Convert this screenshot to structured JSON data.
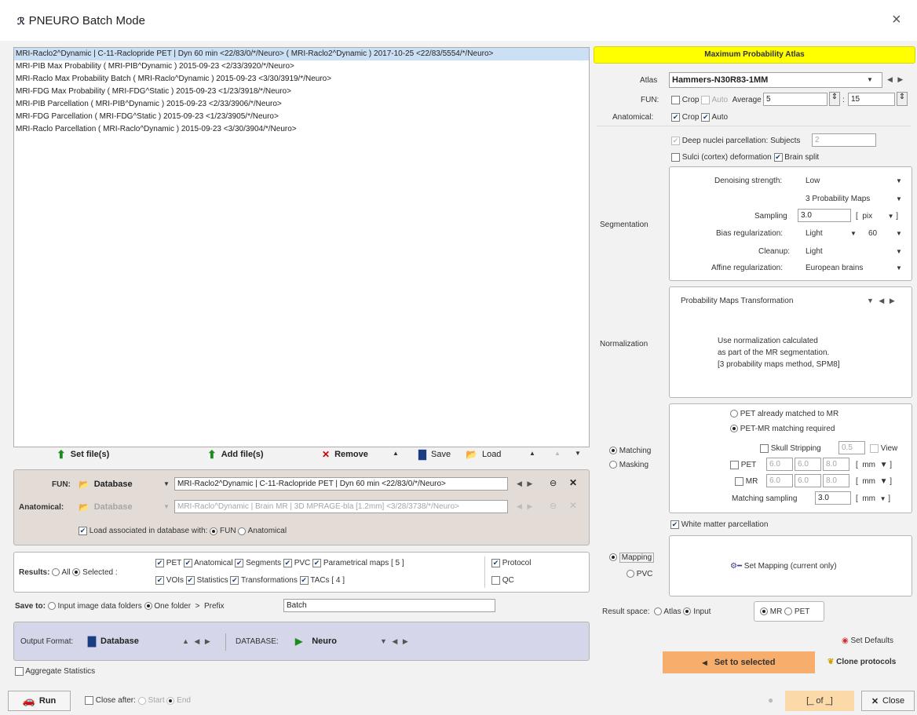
{
  "window": {
    "title": "PNEURO Batch Mode",
    "close": "×"
  },
  "list": [
    "MRI-Raclo2^Dynamic | C-11-Raclopride PET | Dyn 60 min <22/83/0/*/Neuro> ( MRI-Raclo2^Dynamic ) 2017-10-25 <22/83/5554/*/Neuro>",
    "MRI-PIB Max Probability ( MRI-PIB^Dynamic ) 2015-09-23 <2/33/3920/*/Neuro>",
    "MRI-Raclo Max Probability Batch ( MRI-Raclo^Dynamic ) 2015-09-23 <3/30/3919/*/Neuro>",
    "MRI-FDG Max Probability ( MRI-FDG^Static ) 2015-09-23 <1/23/3918/*/Neuro>",
    "MRI-PIB Parcellation ( MRI-PIB^Dynamic ) 2015-09-23 <2/33/3906/*/Neuro>",
    "MRI-FDG Parcellation ( MRI-FDG^Static ) 2015-09-23 <1/23/3905/*/Neuro>",
    "MRI-Raclo Parcellation ( MRI-Raclo^Dynamic ) 2015-09-23 <3/30/3904/*/Neuro>"
  ],
  "toolbar": {
    "set_files": "Set file(s)",
    "add_files": "Add file(s)",
    "remove": "Remove",
    "save": "Save",
    "load": "Load"
  },
  "inputs": {
    "fun_label": "FUN:",
    "fun_source": "Database",
    "fun_value": "MRI-Raclo2^Dynamic | C-11-Raclopride PET | Dyn 60 min <22/83/0/*/Neuro>",
    "anat_label": "Anatomical:",
    "anat_source": "Database",
    "anat_value": "MRI-Raclo^Dynamic | Brain MR | 3D MPRAGE-bla [1.2mm] <3/28/3738/*/Neuro>",
    "load_assoc": "Load associated in database with:",
    "opt_fun": "FUN",
    "opt_anat": "Anatomical"
  },
  "results": {
    "label": "Results:",
    "all": "All",
    "selected": "Selected :",
    "row1": [
      "PET",
      "Anatomical",
      "Segments",
      "PVC",
      "Parametrical maps"
    ],
    "pm_count": "[ 5 ]",
    "row2": [
      "VOIs",
      "Statistics",
      "Transformations",
      "TACs"
    ],
    "tac_count": "[ 4 ]",
    "protocol": "Protocol",
    "qc": "QC"
  },
  "save": {
    "label": "Save to:",
    "opt1": "Input image data folders",
    "opt2": "One folder",
    "arrow": ">",
    "prefix_label": "Prefix",
    "prefix_value": "Batch"
  },
  "output": {
    "label": "Output Format:",
    "format": "Database",
    "db_label": "DATABASE:",
    "db_value": "Neuro"
  },
  "aggregate": "Aggregate Statistics",
  "bottom": {
    "run": "Run",
    "close_after": "Close after:",
    "start": "Start",
    "end": "End",
    "page": "[_ of _]",
    "close": "Close"
  },
  "right": {
    "banner": "Maximum Probability Atlas",
    "atlas_label": "Atlas",
    "atlas_value": "Hammers-N30R83-1MM",
    "fun_label": "FUN:",
    "crop": "Crop",
    "auto": "Auto",
    "average": "Average",
    "avg1": "5",
    "avg2": "15",
    "anat_label": "Anatomical:",
    "deep_nuclei": "Deep nuclei parcellation:",
    "subjects": "Subjects",
    "subjects_value": "2",
    "sulci": "Sulci (cortex) deformation",
    "brain_split": "Brain split",
    "segmentation": "Segmentation",
    "denoise_label": "Denoising strength:",
    "denoise_value": "Low",
    "prob_maps": "3 Probability Maps",
    "sampling_label": "Sampling",
    "sampling_value": "3.0",
    "sampling_unit": "pix",
    "bias_label": "Bias regularization:",
    "bias_value": "Light",
    "bias_num": "60",
    "cleanup_label": "Cleanup:",
    "cleanup_value": "Light",
    "affine_label": "Affine regularization:",
    "affine_value": "European brains",
    "normalization": "Normalization",
    "pmt": "Probability Maps Transformation",
    "norm_text1": "Use normalization calculated",
    "norm_text2": "as part of the MR segmentation.",
    "norm_text3": "[3 probability maps method, SPM8]",
    "matching": "Matching",
    "masking": "Masking",
    "pet_matched": "PET already matched to MR",
    "pet_mr_req": "PET-MR matching required",
    "skull": "Skull Stripping",
    "skull_val": "0.5",
    "view": "View",
    "pet": "PET",
    "mr": "MR",
    "v6": "6.0",
    "v8": "8.0",
    "mm": "mm",
    "match_sampling": "Matching sampling",
    "match_sampling_value": "3.0",
    "wm": "White matter parcellation",
    "mapping": "Mapping",
    "pvc": "PVC",
    "set_mapping": "Set Mapping (current only)",
    "result_space": "Result space:",
    "atlas": "Atlas",
    "input": "Input",
    "mr_opt": "MR",
    "pet_opt": "PET",
    "set_defaults": "Set Defaults",
    "set_to_selected": "Set to selected",
    "clone": "Clone protocols"
  }
}
